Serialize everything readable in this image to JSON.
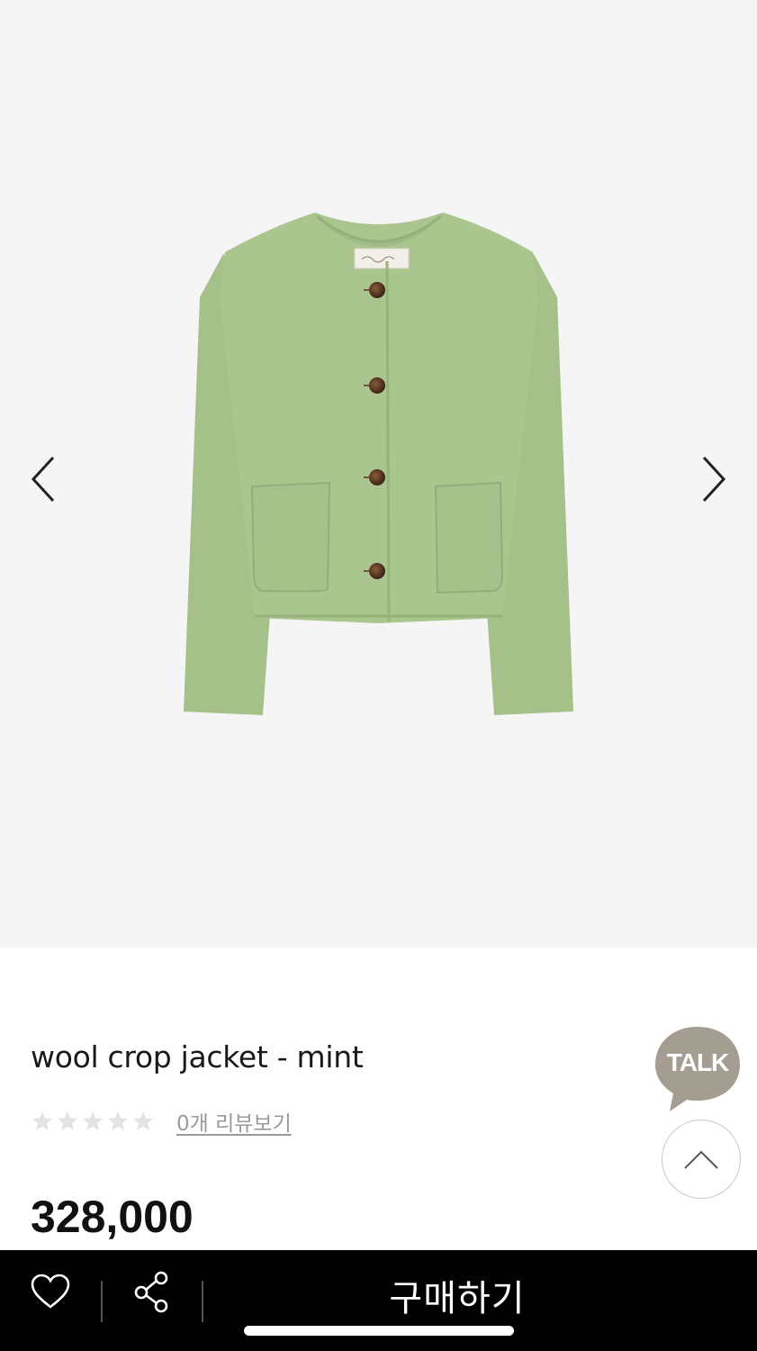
{
  "product": {
    "title": "wool crop jacket - mint",
    "review_link": "0개 리뷰보기",
    "price": "328,000",
    "rating_stars": 0,
    "rating_max": 5
  },
  "floating": {
    "talk_label": "TALK"
  },
  "bottom_bar": {
    "buy_label": "구매하기"
  },
  "colors": {
    "gallery_bg": "#f5f5f5",
    "jacket": "#a9c48c",
    "talk_bubble": "#a49e92",
    "star_empty": "#e3e3e3",
    "bottom_bar_bg": "#000000"
  },
  "icons": [
    "chevron-left-icon",
    "chevron-right-icon",
    "heart-icon",
    "share-icon",
    "chevron-up-icon",
    "talk-bubble-icon",
    "star-icon"
  ]
}
